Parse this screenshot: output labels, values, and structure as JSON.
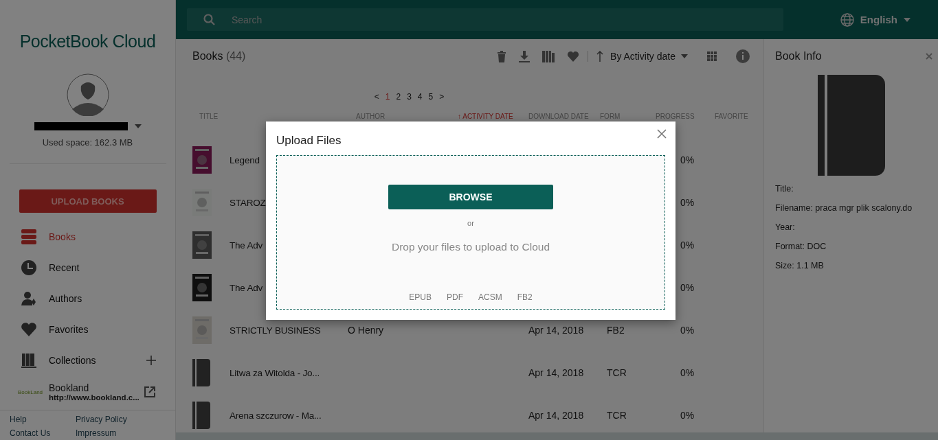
{
  "sidebar": {
    "logo": {
      "brand": "PocketBook",
      "product": "Cloud"
    },
    "used_space": "Used space: 162.3 MB",
    "upload_button": "UPLOAD BOOKS",
    "items": [
      {
        "label": "Books",
        "kind": "books",
        "selected": true
      },
      {
        "label": "Recent",
        "kind": "recent",
        "selected": false
      },
      {
        "label": "Authors",
        "kind": "authors",
        "selected": false
      },
      {
        "label": "Favorites",
        "kind": "favorites",
        "selected": false
      },
      {
        "label": "Collections",
        "kind": "collections",
        "selected": false
      }
    ],
    "bookland": {
      "logo": "BookLand",
      "name": "Bookland",
      "url": "http://www.bookland.c..."
    },
    "footer_links": [
      "Help",
      "Privacy Policy",
      "Contact Us",
      "Impressum"
    ]
  },
  "search": {
    "placeholder": "Search"
  },
  "language": "English",
  "books": {
    "title": "Books",
    "count": "(44)",
    "sort": "By Activity date",
    "pages": [
      {
        "label": "1",
        "selected": true
      },
      {
        "label": "2",
        "selected": false
      },
      {
        "label": "3",
        "selected": false
      },
      {
        "label": "4",
        "selected": false
      },
      {
        "label": "5",
        "selected": false
      }
    ],
    "prev": "<",
    "next": ">",
    "columns": [
      "TITLE",
      "AUTHOR",
      "↑ ACTIVITY DATE",
      "DOWNLOAD DATE",
      "FORM",
      "PROGRESS",
      "FAVORITE"
    ],
    "rows": [
      {
        "kind": "cover",
        "title": "Legend",
        "progress": "0%"
      },
      {
        "kind": "cover",
        "title": "STAROZ",
        "progress": "0%"
      },
      {
        "kind": "cover",
        "title": "The Adv",
        "progress": "0%"
      },
      {
        "kind": "cover",
        "title": "The Adv",
        "progress": "0%"
      },
      {
        "kind": "cover",
        "title": "STRICTLY BUSINESS",
        "author": "O Henry",
        "date": "Apr 14, 2018",
        "format": "FB2",
        "progress": "0%"
      },
      {
        "kind": "placeholder",
        "title": "Litwa za Witolda - Jo...",
        "date": "Apr 14, 2018",
        "format": "TCR",
        "progress": "0%"
      },
      {
        "kind": "placeholder",
        "title": "Arena szczurow - Ma...",
        "date": "Apr 14, 2018",
        "format": "TCR",
        "progress": "0%"
      }
    ]
  },
  "book_info": {
    "title": "Book Info",
    "fields": [
      {
        "label": "Title:"
      },
      {
        "label": "Filename:",
        "value": "praca mgr plik scalony.do"
      },
      {
        "label": "Year:"
      },
      {
        "label": "Format:",
        "value": "DOC"
      },
      {
        "label": "Size:",
        "value": "1.1 MB"
      }
    ]
  },
  "dialog": {
    "title": "Upload Files",
    "button": "BROWSE",
    "or": "or",
    "hint": "Drop your files to upload to Cloud",
    "formats": [
      "EPUB",
      "PDF",
      "ACSM",
      "FB2"
    ]
  }
}
